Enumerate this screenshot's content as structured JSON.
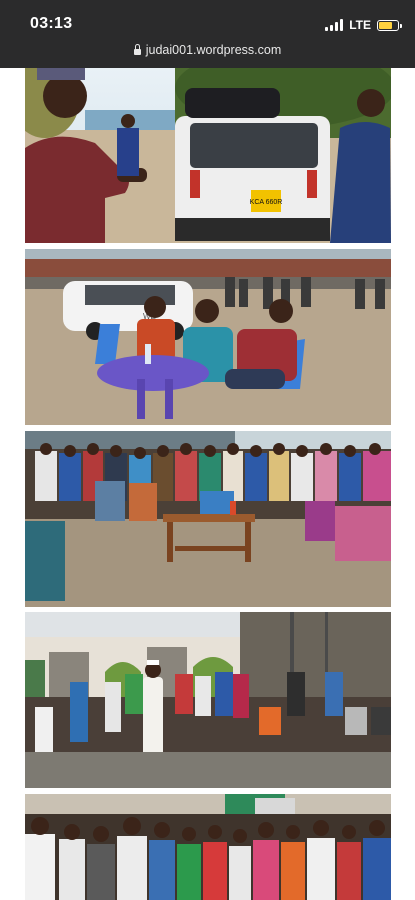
{
  "status_bar": {
    "time": "03:13",
    "network": "LTE",
    "battery_level": 0.75
  },
  "browser": {
    "url": "judai001.wordpress.com",
    "lock_icon": "lock-icon"
  },
  "photos": [
    {
      "plate_text": "KCA 660R"
    },
    {
      "vehicle_text": "WE"
    },
    {},
    {},
    {}
  ],
  "colors": {
    "status_bg": "#2b2b2c",
    "page_bg": "#ffffff",
    "battery_fill": "#ffd23f"
  }
}
